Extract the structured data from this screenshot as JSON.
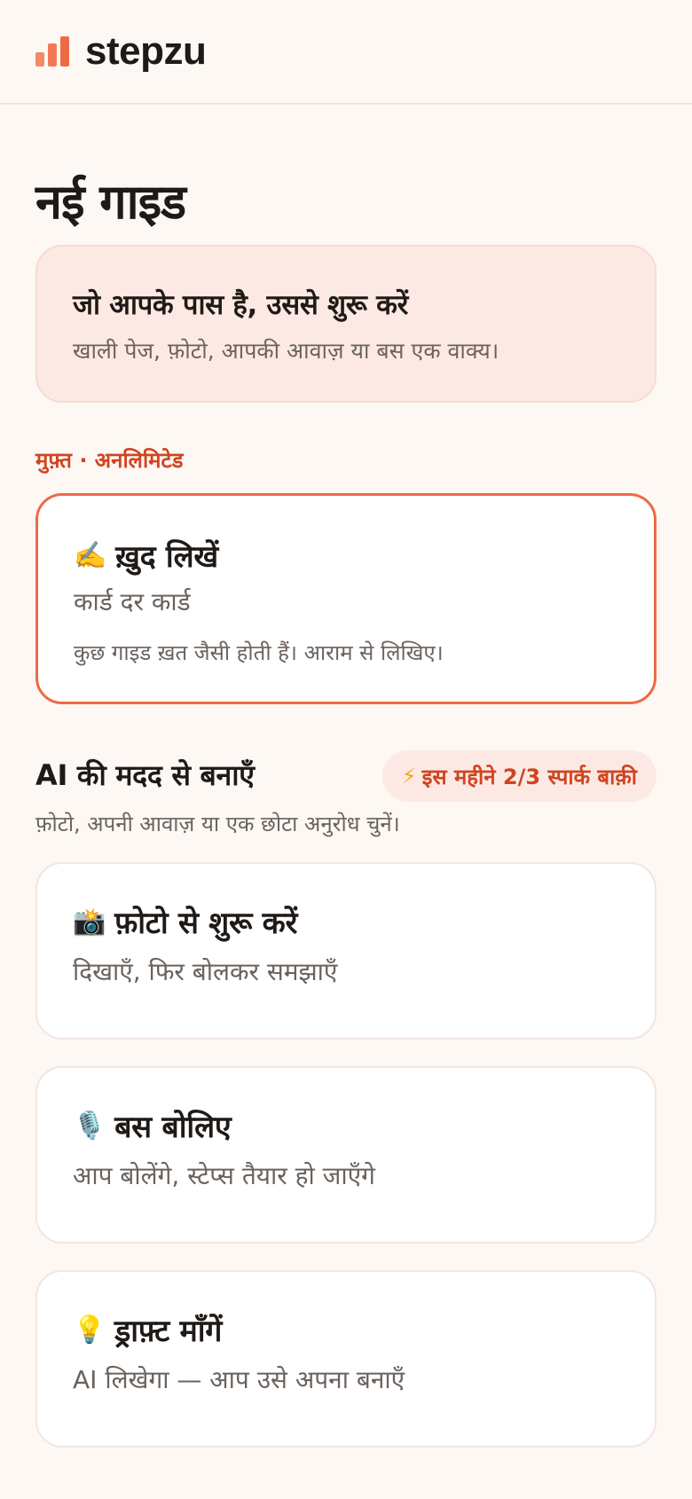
{
  "header": {
    "brand": "stepzu",
    "logo_icon": "bar-chart-logo-icon"
  },
  "page": {
    "title": "नई गाइड"
  },
  "intro": {
    "title": "जो आपके पास है, उससे शुरू करें",
    "subtitle": "खाली पेज, फ़ोटो, आपकी आवाज़ या बस एक वाक्य।"
  },
  "free_section": {
    "label": "मुफ़्त · अनलिमिटेड"
  },
  "write_option": {
    "emoji": "✍️",
    "title": "ख़ुद लिखें",
    "subtitle": "कार्ड दर कार्ड",
    "note": "कुछ गाइड ख़त जैसी होती हैं। आराम से लिखिए।"
  },
  "ai_section": {
    "heading": "AI की मदद से बनाएँ",
    "badge_icon": "⚡",
    "badge": "इस महीने 2/3 स्पार्क बाक़ी",
    "subtitle": "फ़ोटो, अपनी आवाज़ या एक छोटा अनुरोध चुनें।"
  },
  "photo_option": {
    "emoji": "📸",
    "title": "फ़ोटो से शुरू करें",
    "subtitle": "दिखाएँ, फिर बोलकर समझाएँ"
  },
  "voice_option": {
    "emoji": "🎙️",
    "title": "बस बोलिए",
    "subtitle": "आप बोलेंगे, स्टेप्स तैयार हो जाएँगे"
  },
  "draft_option": {
    "emoji": "💡",
    "title": "ड्राफ़्ट माँगें",
    "subtitle": "AI लिखेगा — आप उसे अपना बनाएँ"
  },
  "colors": {
    "accent": "#ee6a45",
    "accent_text": "#d0441f",
    "tint": "#fde9e3",
    "background": "#fdf8f4"
  }
}
